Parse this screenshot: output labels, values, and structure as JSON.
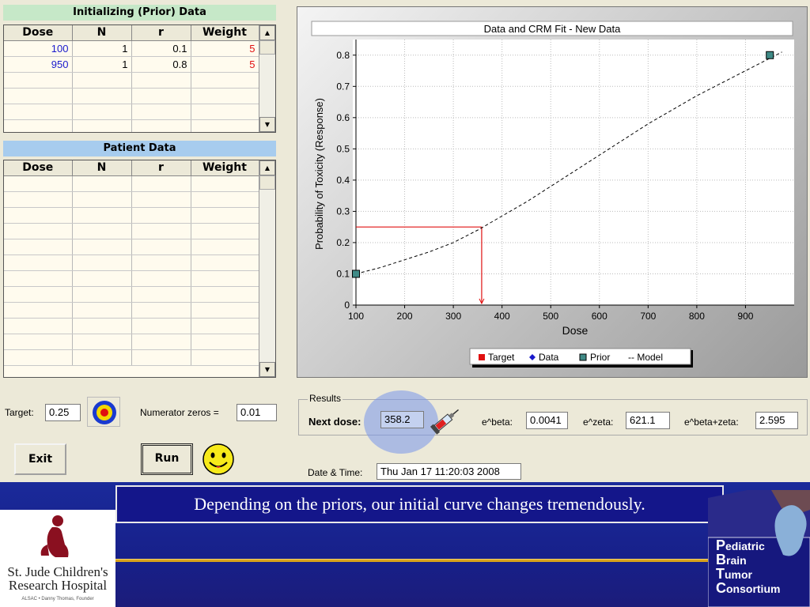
{
  "prior_table": {
    "title": "Initializing (Prior) Data",
    "headers": [
      "Dose",
      "N",
      "r",
      "Weight"
    ],
    "rows": [
      {
        "dose": "100",
        "n": "1",
        "r": "0.1",
        "weight": "5"
      },
      {
        "dose": "950",
        "n": "1",
        "r": "0.8",
        "weight": "5"
      }
    ]
  },
  "patient_table": {
    "title": "Patient Data",
    "headers": [
      "Dose",
      "N",
      "r",
      "Weight"
    ]
  },
  "controls": {
    "target_label": "Target:",
    "target_value": "0.25",
    "numerator_label": "Numerator zeros =",
    "numerator_value": "0.01",
    "exit_label": "Exit",
    "run_label": "Run"
  },
  "results": {
    "legend": "Results",
    "next_dose_label": "Next dose:",
    "next_dose_value": "358.2",
    "ebeta_label": "e^beta:",
    "ebeta_value": "0.0041",
    "ezeta_label": "e^zeta:",
    "ezeta_value": "621.1",
    "ebetazeta_label": "e^beta+zeta:",
    "ebetazeta_value": "2.595",
    "datetime_label": "Date & Time:",
    "datetime_value": "Thu Jan 17 11:20:03 2008"
  },
  "icons": {
    "target": "bullseye-icon",
    "syringe": "syringe-icon",
    "smiley": "smiley-face-icon"
  },
  "colors": {
    "prior_marker": "#3f8a86",
    "target_line": "#e01010",
    "data_marker": "#1a1acc",
    "model_line": "#000000"
  },
  "chart_data": {
    "type": "line",
    "title": "Data and CRM Fit - New Data",
    "xlabel": "Dose",
    "ylabel": "Probability of Toxicity (Response)",
    "xlim": [
      100,
      1000
    ],
    "ylim": [
      0,
      0.85
    ],
    "xticks": [
      100,
      200,
      300,
      400,
      500,
      600,
      700,
      800,
      900
    ],
    "yticks": [
      0,
      0.1,
      0.2,
      0.3,
      0.4,
      0.5,
      0.6,
      0.7,
      0.8
    ],
    "grid": true,
    "legend": [
      "Target",
      "Data",
      "Prior",
      "-- Model"
    ],
    "legend_position": "bottom-right",
    "series": [
      {
        "name": "Model",
        "style": "dashed",
        "x": [
          100,
          150,
          200,
          250,
          300,
          350,
          400,
          450,
          500,
          550,
          600,
          650,
          700,
          750,
          800,
          850,
          900,
          950,
          975
        ],
        "y": [
          0.1,
          0.12,
          0.145,
          0.17,
          0.2,
          0.24,
          0.285,
          0.33,
          0.38,
          0.43,
          0.48,
          0.53,
          0.58,
          0.625,
          0.67,
          0.71,
          0.75,
          0.79,
          0.81
        ]
      },
      {
        "name": "Prior",
        "x": [
          100,
          950
        ],
        "y": [
          0.1,
          0.8
        ]
      }
    ],
    "target": {
      "y": 0.25,
      "dose": 358.2
    }
  },
  "slide": {
    "caption": "Depending on the priors, our initial curve changes tremendously.",
    "stjude_line1": "St. Jude Children's",
    "stjude_line2": "Research Hospital",
    "stjude_tagline": "ALSAC • Danny Thomas, Founder",
    "pbtc_lines": [
      {
        "cap": "P",
        "rest": "ediatric"
      },
      {
        "cap": "B",
        "rest": "rain"
      },
      {
        "cap": "T",
        "rest": "umor"
      },
      {
        "cap": "C",
        "rest": "onsortium"
      }
    ]
  }
}
